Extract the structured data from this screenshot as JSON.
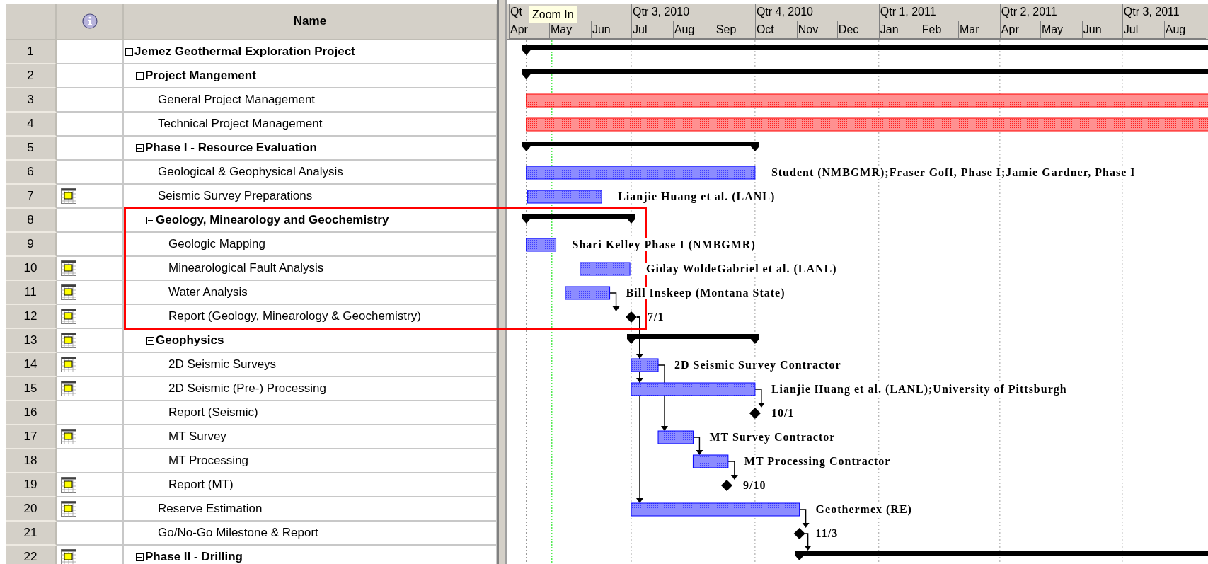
{
  "table": {
    "header": {
      "name": "Name"
    },
    "tasks": [
      {
        "number": "1",
        "name": "Jemez Geothermal Exploration Project",
        "expanded": true,
        "calendar_indicator": false,
        "highlighted": false,
        "bar": {
          "kind": "summary"
        },
        "children": [
          {
            "number": "2",
            "name": "Project Mangement",
            "expanded": true,
            "calendar_indicator": false,
            "highlighted": false,
            "bar": {
              "kind": "summary"
            },
            "children": [
              {
                "number": "3",
                "name": "General Project Management",
                "calendar_indicator": false,
                "highlighted": false,
                "bar": {
                  "kind": "critical"
                }
              },
              {
                "number": "4",
                "name": "Technical Project Management",
                "calendar_indicator": false,
                "highlighted": false,
                "bar": {
                  "kind": "critical"
                }
              }
            ]
          },
          {
            "number": "5",
            "name": "Phase I - Resource Evaluation",
            "expanded": true,
            "calendar_indicator": false,
            "highlighted": false,
            "bar": {
              "kind": "summary"
            },
            "children": [
              {
                "number": "6",
                "name": "Geological & Geophysical Analysis",
                "calendar_indicator": false,
                "highlighted": false,
                "bar": {
                  "kind": "task",
                  "label": "Student (NMBGMR);Fraser Goff, Phase I;Jamie Gardner, Phase I"
                }
              },
              {
                "number": "7",
                "name": "Seismic Survey Preparations",
                "calendar_indicator": true,
                "highlighted": false,
                "bar": {
                  "kind": "task",
                  "label": "Lianjie Huang et al. (LANL)"
                }
              },
              {
                "number": "8",
                "name": "Geology, Minearology and Geochemistry",
                "expanded": true,
                "calendar_indicator": false,
                "highlighted": true,
                "bar": {
                  "kind": "summary"
                },
                "children": [
                  {
                    "number": "9",
                    "name": "Geologic Mapping",
                    "calendar_indicator": false,
                    "highlighted": true,
                    "bar": {
                      "kind": "task",
                      "label": "Shari Kelley Phase I (NMBGMR)"
                    }
                  },
                  {
                    "number": "10",
                    "name": "Minearological Fault Analysis",
                    "calendar_indicator": true,
                    "highlighted": true,
                    "bar": {
                      "kind": "task",
                      "label": "Giday WoldeGabriel et al. (LANL)"
                    }
                  },
                  {
                    "number": "11",
                    "name": "Water Analysis",
                    "calendar_indicator": true,
                    "highlighted": true,
                    "bar": {
                      "kind": "task",
                      "label": "Bill Inskeep (Montana State)"
                    }
                  },
                  {
                    "number": "12",
                    "name": "Report (Geology, Minearology & Geochemistry)",
                    "calendar_indicator": true,
                    "highlighted": true,
                    "bar": {
                      "kind": "milestone",
                      "label": "7/1"
                    }
                  }
                ]
              },
              {
                "number": "13",
                "name": "Geophysics",
                "expanded": true,
                "calendar_indicator": true,
                "highlighted": false,
                "bar": {
                  "kind": "summary"
                },
                "children": [
                  {
                    "number": "14",
                    "name": "2D Seismic Surveys",
                    "calendar_indicator": true,
                    "highlighted": false,
                    "bar": {
                      "kind": "task",
                      "label": "2D Seismic Survey Contractor"
                    }
                  },
                  {
                    "number": "15",
                    "name": "2D Seismic (Pre-) Processing",
                    "calendar_indicator": true,
                    "highlighted": false,
                    "bar": {
                      "kind": "task",
                      "label": "Lianjie Huang et al. (LANL);University of Pittsburgh"
                    }
                  },
                  {
                    "number": "16",
                    "name": "Report (Seismic)",
                    "calendar_indicator": false,
                    "highlighted": false,
                    "bar": {
                      "kind": "milestone",
                      "label": "10/1"
                    }
                  },
                  {
                    "number": "17",
                    "name": "MT Survey",
                    "calendar_indicator": true,
                    "highlighted": false,
                    "bar": {
                      "kind": "task",
                      "label": "MT Survey Contractor"
                    }
                  },
                  {
                    "number": "18",
                    "name": "MT Processing",
                    "calendar_indicator": false,
                    "highlighted": false,
                    "bar": {
                      "kind": "task",
                      "label": "MT Processing Contractor"
                    }
                  },
                  {
                    "number": "19",
                    "name": "Report (MT)",
                    "calendar_indicator": true,
                    "highlighted": false,
                    "bar": {
                      "kind": "milestone",
                      "label": "9/10"
                    }
                  }
                ]
              },
              {
                "number": "20",
                "name": "Reserve Estimation",
                "calendar_indicator": true,
                "highlighted": false,
                "bar": {
                  "kind": "task",
                  "label": "Geothermex (RE)"
                }
              },
              {
                "number": "21",
                "name": "Go/No-Go Milestone & Report",
                "calendar_indicator": false,
                "highlighted": false,
                "bar": {
                  "kind": "milestone",
                  "label": "11/3"
                }
              }
            ]
          },
          {
            "number": "22",
            "name": "Phase II - Drilling",
            "expanded": true,
            "calendar_indicator": true,
            "highlighted": false,
            "bar": {
              "kind": "summary"
            }
          }
        ]
      }
    ]
  },
  "gantt": {
    "quarters": [
      "Qt",
      "Qtr 3, 2010",
      "Qtr 4, 2010",
      "Qtr 1, 2011",
      "Qtr 2, 2011",
      "Qtr 3, 2011"
    ],
    "months": [
      "Apr",
      "May",
      "Jun",
      "Jul",
      "Aug",
      "Sep",
      "Oct",
      "Nov",
      "Dec",
      "Jan",
      "Feb",
      "Mar",
      "Apr",
      "May",
      "Jun",
      "Jul",
      "Aug"
    ],
    "tooltip": "Zoom In"
  }
}
